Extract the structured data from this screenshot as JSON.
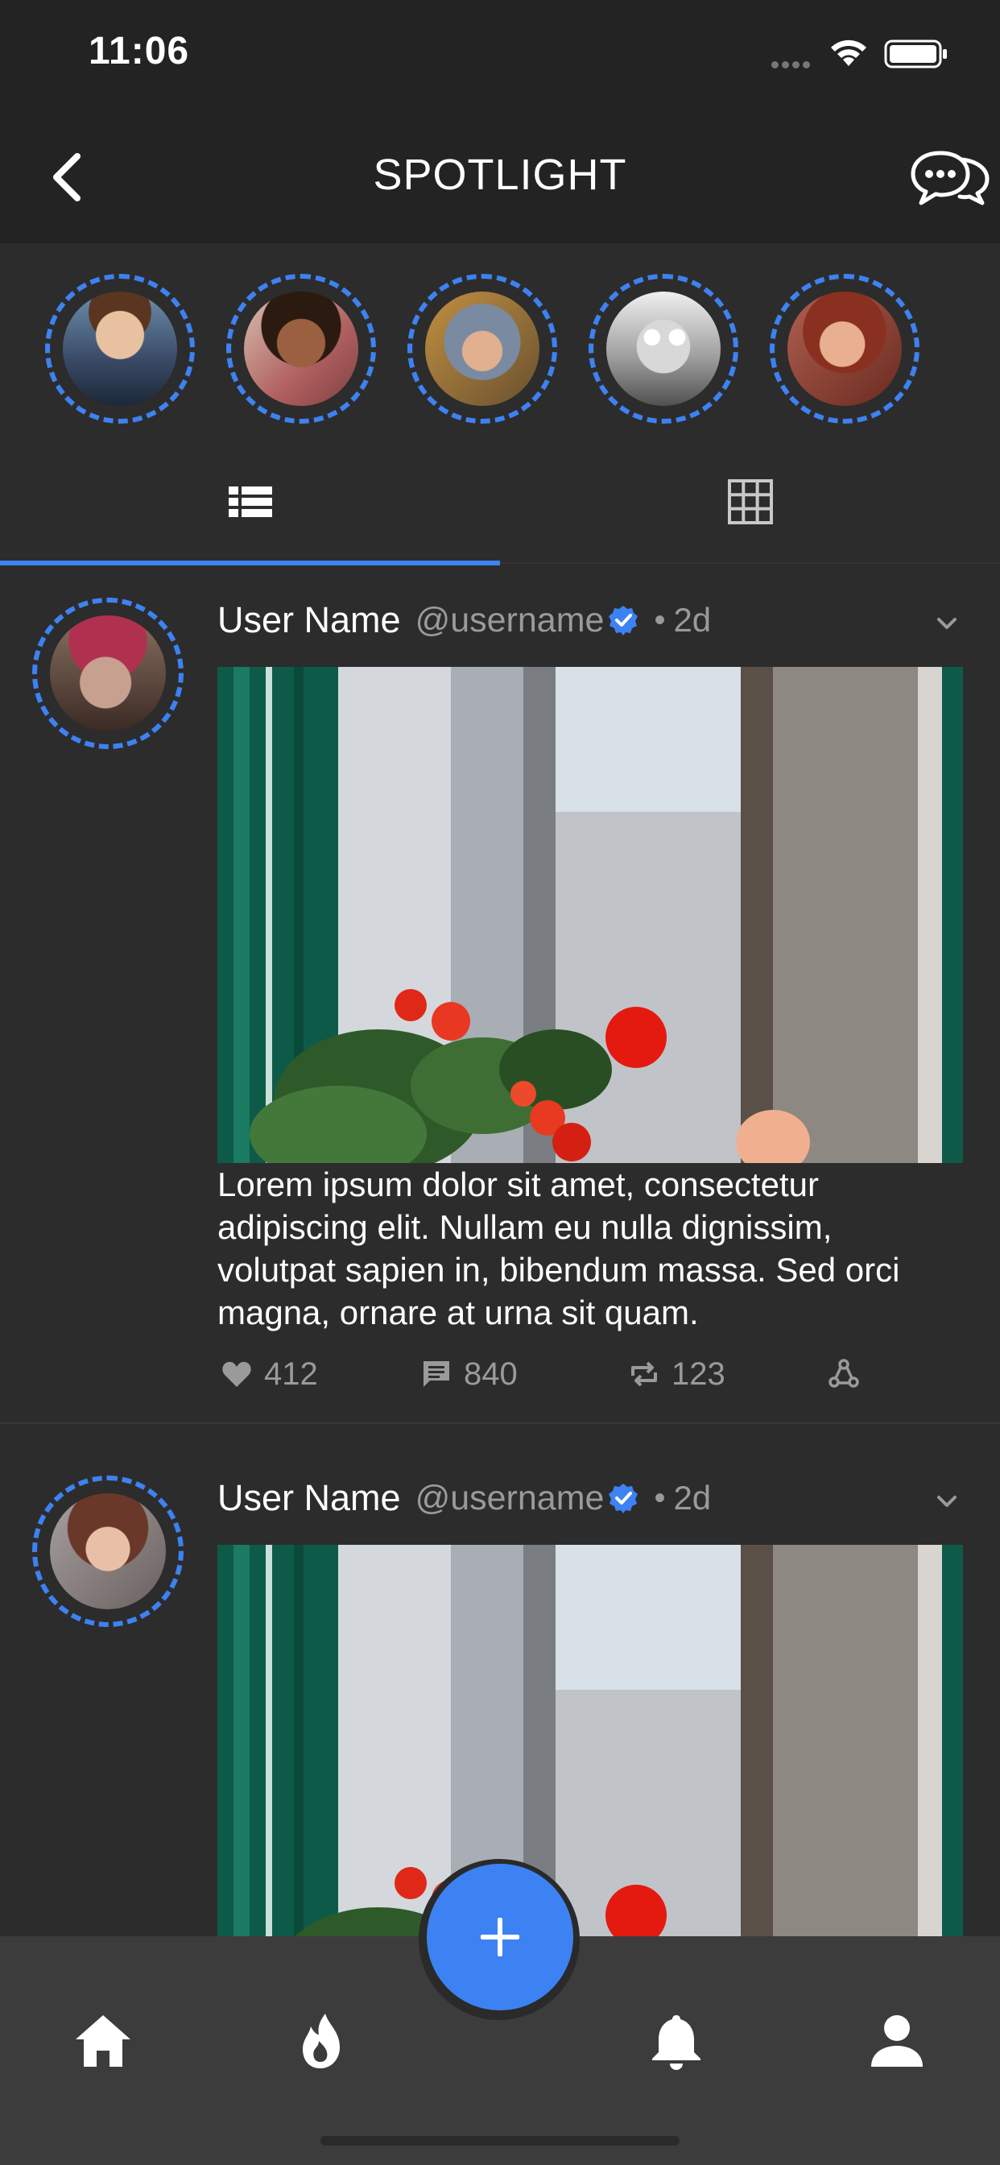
{
  "status_bar": {
    "time": "11:06"
  },
  "nav": {
    "title": "SPOTLIGHT"
  },
  "stories": [
    {
      "name": "story-avatar-1"
    },
    {
      "name": "story-avatar-2"
    },
    {
      "name": "story-avatar-3"
    },
    {
      "name": "story-avatar-4"
    },
    {
      "name": "story-avatar-5"
    }
  ],
  "tabs": {
    "active": "list",
    "items": [
      "list-view",
      "grid-view"
    ]
  },
  "posts": [
    {
      "user_name": "User Name",
      "handle": "@username",
      "separator": "•",
      "age": "2d",
      "caption": "Lorem ipsum dolor sit amet, consectetur adipiscing elit. Nullam eu nulla dignissim, volutpat sapien in, bibendum massa. Sed orci magna, ornare at urna sit quam.",
      "likes": "412",
      "comments": "840",
      "reposts": "123"
    },
    {
      "user_name": "User Name",
      "handle": "@username",
      "separator": "•",
      "age": "2d"
    }
  ],
  "colors": {
    "accent": "#3d82f2",
    "background": "#2c2c2c",
    "bar": "#232323",
    "bottom_bar": "#3c3c3c",
    "muted_text": "#9a9a9a"
  }
}
